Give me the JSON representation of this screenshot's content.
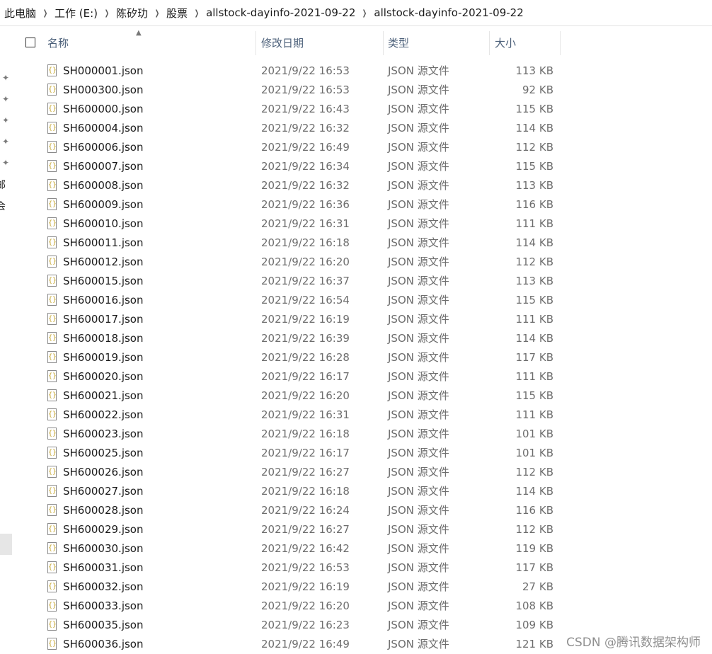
{
  "breadcrumb": [
    "此电脑",
    "工作 (E:)",
    "陈矽玏",
    "股票",
    "allstock-dayinfo-2021-09-22",
    "allstock-dayinfo-2021-09-22"
  ],
  "nav_fragments": [
    "邮",
    "会"
  ],
  "columns": {
    "name": "名称",
    "date": "修改日期",
    "type": "类型",
    "size": "大小"
  },
  "files": [
    {
      "name": "SH000001.json",
      "date": "2021/9/22 16:53",
      "type": "JSON 源文件",
      "size": "113 KB"
    },
    {
      "name": "SH000300.json",
      "date": "2021/9/22 16:53",
      "type": "JSON 源文件",
      "size": "92 KB"
    },
    {
      "name": "SH600000.json",
      "date": "2021/9/22 16:43",
      "type": "JSON 源文件",
      "size": "115 KB"
    },
    {
      "name": "SH600004.json",
      "date": "2021/9/22 16:32",
      "type": "JSON 源文件",
      "size": "114 KB"
    },
    {
      "name": "SH600006.json",
      "date": "2021/9/22 16:49",
      "type": "JSON 源文件",
      "size": "112 KB"
    },
    {
      "name": "SH600007.json",
      "date": "2021/9/22 16:34",
      "type": "JSON 源文件",
      "size": "115 KB"
    },
    {
      "name": "SH600008.json",
      "date": "2021/9/22 16:32",
      "type": "JSON 源文件",
      "size": "113 KB"
    },
    {
      "name": "SH600009.json",
      "date": "2021/9/22 16:36",
      "type": "JSON 源文件",
      "size": "116 KB"
    },
    {
      "name": "SH600010.json",
      "date": "2021/9/22 16:31",
      "type": "JSON 源文件",
      "size": "111 KB"
    },
    {
      "name": "SH600011.json",
      "date": "2021/9/22 16:18",
      "type": "JSON 源文件",
      "size": "114 KB"
    },
    {
      "name": "SH600012.json",
      "date": "2021/9/22 16:20",
      "type": "JSON 源文件",
      "size": "112 KB"
    },
    {
      "name": "SH600015.json",
      "date": "2021/9/22 16:37",
      "type": "JSON 源文件",
      "size": "113 KB"
    },
    {
      "name": "SH600016.json",
      "date": "2021/9/22 16:54",
      "type": "JSON 源文件",
      "size": "115 KB"
    },
    {
      "name": "SH600017.json",
      "date": "2021/9/22 16:19",
      "type": "JSON 源文件",
      "size": "111 KB"
    },
    {
      "name": "SH600018.json",
      "date": "2021/9/22 16:39",
      "type": "JSON 源文件",
      "size": "114 KB"
    },
    {
      "name": "SH600019.json",
      "date": "2021/9/22 16:28",
      "type": "JSON 源文件",
      "size": "117 KB"
    },
    {
      "name": "SH600020.json",
      "date": "2021/9/22 16:17",
      "type": "JSON 源文件",
      "size": "111 KB"
    },
    {
      "name": "SH600021.json",
      "date": "2021/9/22 16:20",
      "type": "JSON 源文件",
      "size": "115 KB"
    },
    {
      "name": "SH600022.json",
      "date": "2021/9/22 16:31",
      "type": "JSON 源文件",
      "size": "111 KB"
    },
    {
      "name": "SH600023.json",
      "date": "2021/9/22 16:18",
      "type": "JSON 源文件",
      "size": "101 KB"
    },
    {
      "name": "SH600025.json",
      "date": "2021/9/22 16:17",
      "type": "JSON 源文件",
      "size": "101 KB"
    },
    {
      "name": "SH600026.json",
      "date": "2021/9/22 16:27",
      "type": "JSON 源文件",
      "size": "112 KB"
    },
    {
      "name": "SH600027.json",
      "date": "2021/9/22 16:18",
      "type": "JSON 源文件",
      "size": "114 KB"
    },
    {
      "name": "SH600028.json",
      "date": "2021/9/22 16:24",
      "type": "JSON 源文件",
      "size": "116 KB"
    },
    {
      "name": "SH600029.json",
      "date": "2021/9/22 16:27",
      "type": "JSON 源文件",
      "size": "112 KB"
    },
    {
      "name": "SH600030.json",
      "date": "2021/9/22 16:42",
      "type": "JSON 源文件",
      "size": "119 KB"
    },
    {
      "name": "SH600031.json",
      "date": "2021/9/22 16:53",
      "type": "JSON 源文件",
      "size": "117 KB"
    },
    {
      "name": "SH600032.json",
      "date": "2021/9/22 16:19",
      "type": "JSON 源文件",
      "size": "27 KB"
    },
    {
      "name": "SH600033.json",
      "date": "2021/9/22 16:20",
      "type": "JSON 源文件",
      "size": "108 KB"
    },
    {
      "name": "SH600035.json",
      "date": "2021/9/22 16:23",
      "type": "JSON 源文件",
      "size": "109 KB"
    },
    {
      "name": "SH600036.json",
      "date": "2021/9/22 16:49",
      "type": "JSON 源文件",
      "size": "121 KB"
    }
  ],
  "watermark": "CSDN @腾讯数据架构师"
}
